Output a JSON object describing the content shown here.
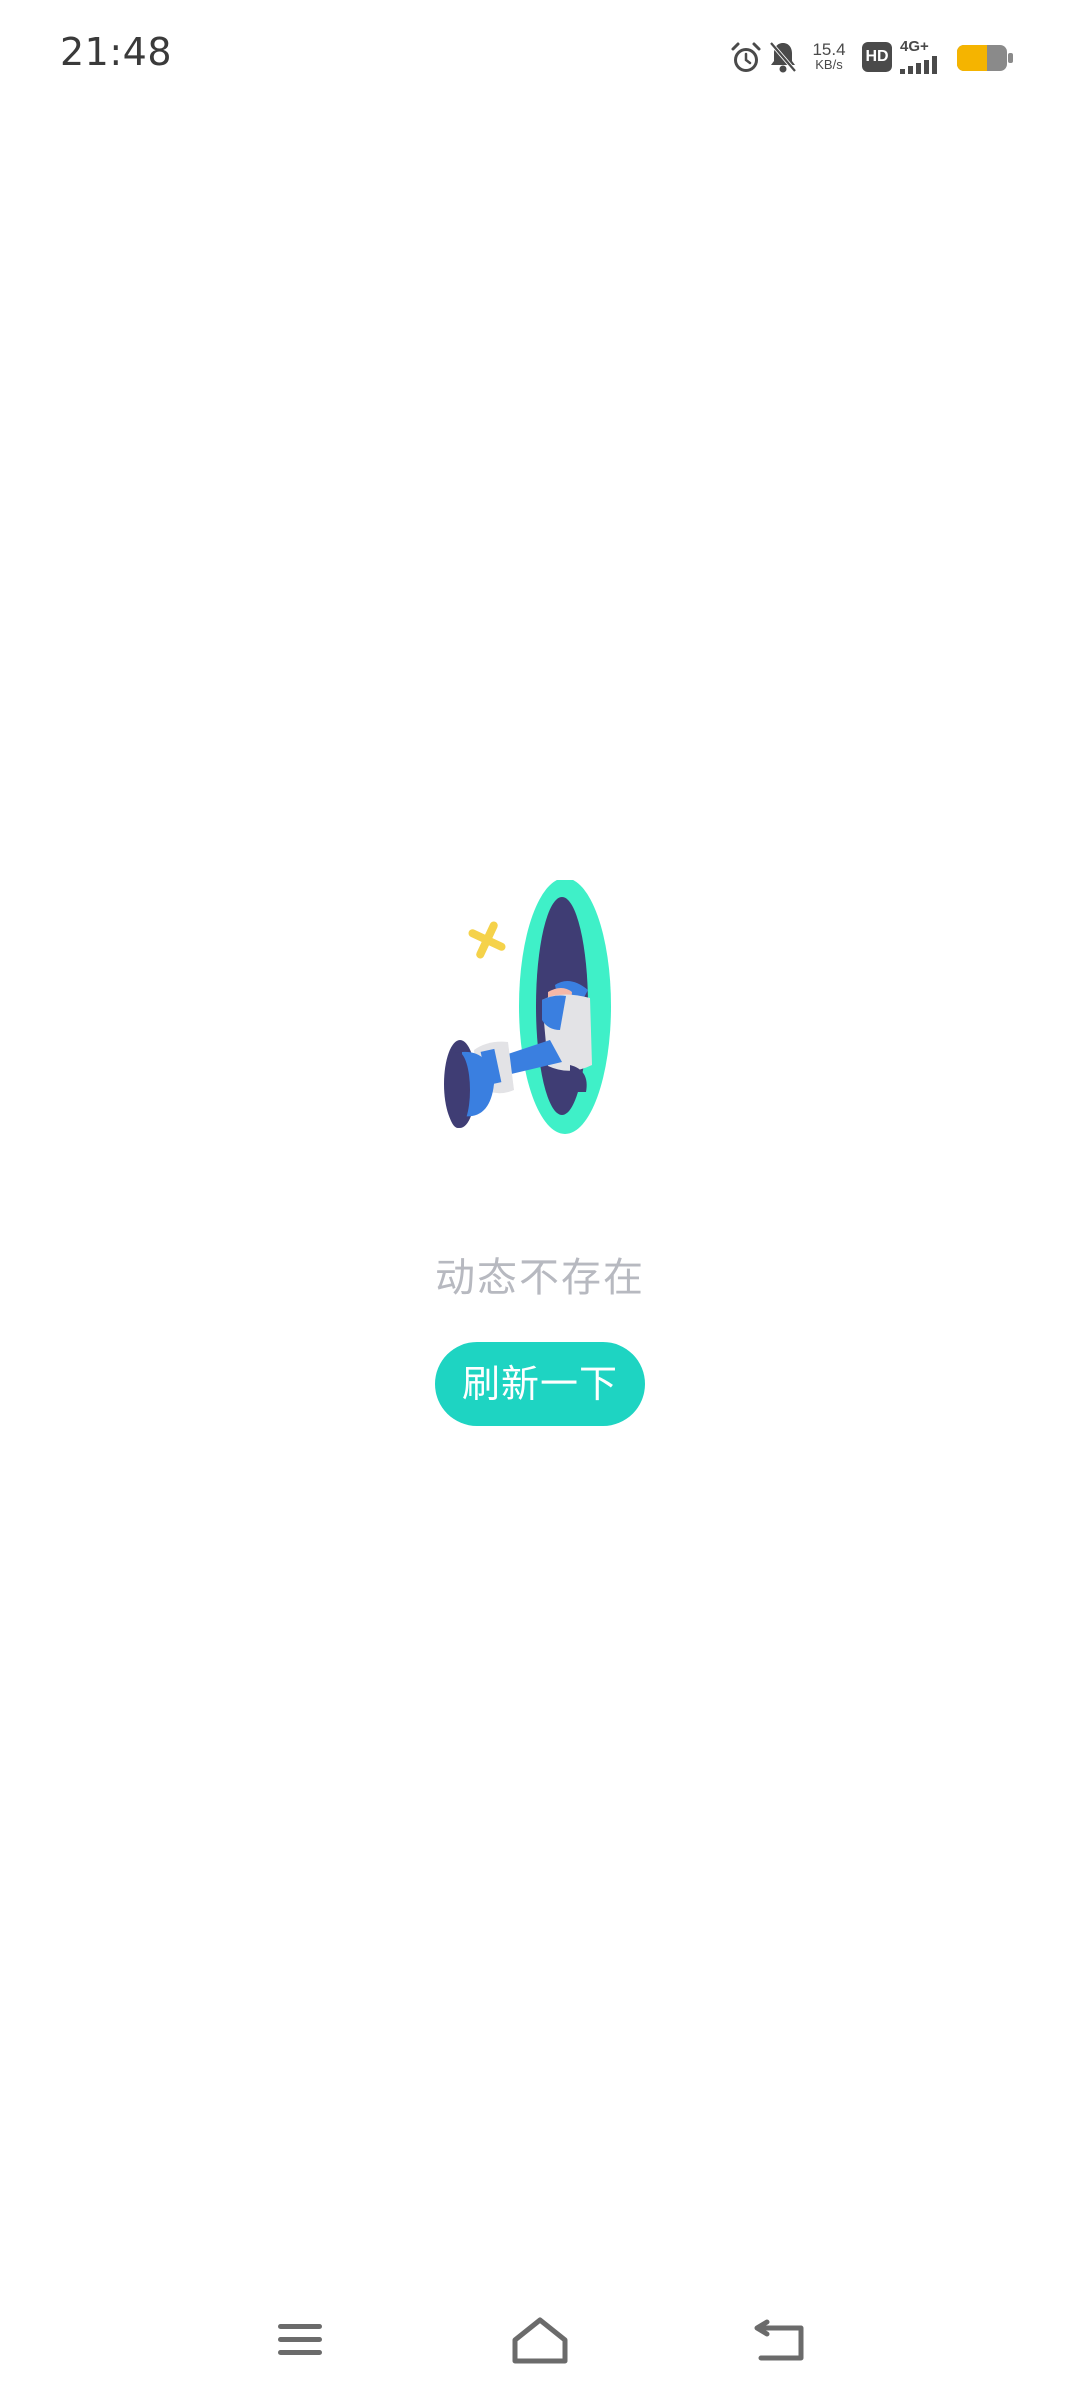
{
  "status_bar": {
    "time": "21:48",
    "net_speed_value": "15.4",
    "net_speed_unit": "KB/s",
    "hd_label": "HD",
    "network_label": "4G+",
    "battery_color": "#f5b400",
    "icons": [
      "alarm-icon",
      "mute-icon",
      "hd-icon",
      "signal-icon",
      "battery-icon"
    ]
  },
  "empty_state": {
    "message": "动态不存在",
    "refresh_label": "刷新一下",
    "accent_color": "#1ed4c2"
  },
  "nav_bar": {
    "icons": [
      "menu-icon",
      "home-icon",
      "back-icon"
    ]
  }
}
